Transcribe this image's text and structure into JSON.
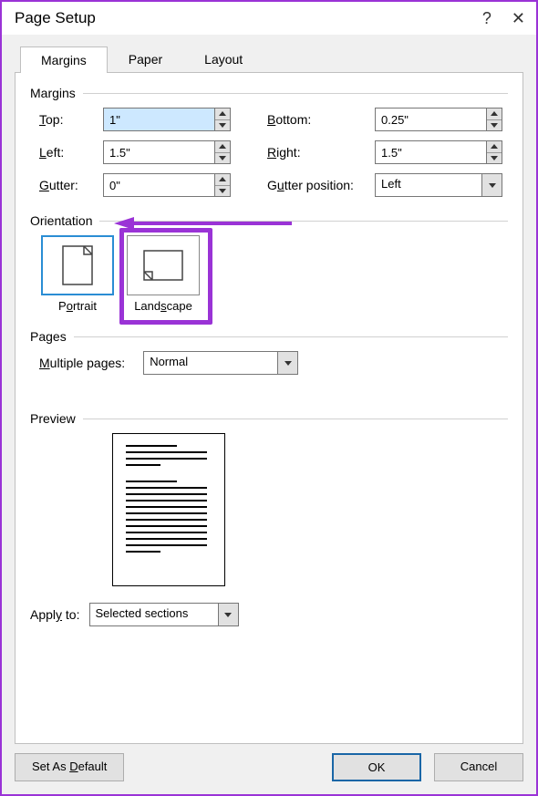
{
  "window": {
    "title": "Page Setup"
  },
  "tabs": {
    "margins": "Margins",
    "paper": "Paper",
    "layout": "Layout"
  },
  "sections": {
    "margins_title": "Margins",
    "orientation_title": "Orientation",
    "pages_title": "Pages",
    "preview_title": "Preview"
  },
  "margins": {
    "top_label": "Top:",
    "top_value": "1\"",
    "bottom_label": "Bottom:",
    "bottom_value": "0.25\"",
    "left_label": "Left:",
    "left_value": "1.5\"",
    "right_label": "Right:",
    "right_value": "1.5\"",
    "gutter_label": "Gutter:",
    "gutter_value": "0\"",
    "gutter_pos_label": "Gutter position:",
    "gutter_pos_value": "Left"
  },
  "orientation": {
    "portrait_label": "Portrait",
    "landscape_label": "Landscape",
    "selected": "portrait"
  },
  "pages": {
    "multi_label": "Multiple pages:",
    "multi_value": "Normal"
  },
  "apply": {
    "label": "Apply to:",
    "value": "Selected sections"
  },
  "buttons": {
    "set_default": "Set As Default",
    "ok": "OK",
    "cancel": "Cancel"
  }
}
